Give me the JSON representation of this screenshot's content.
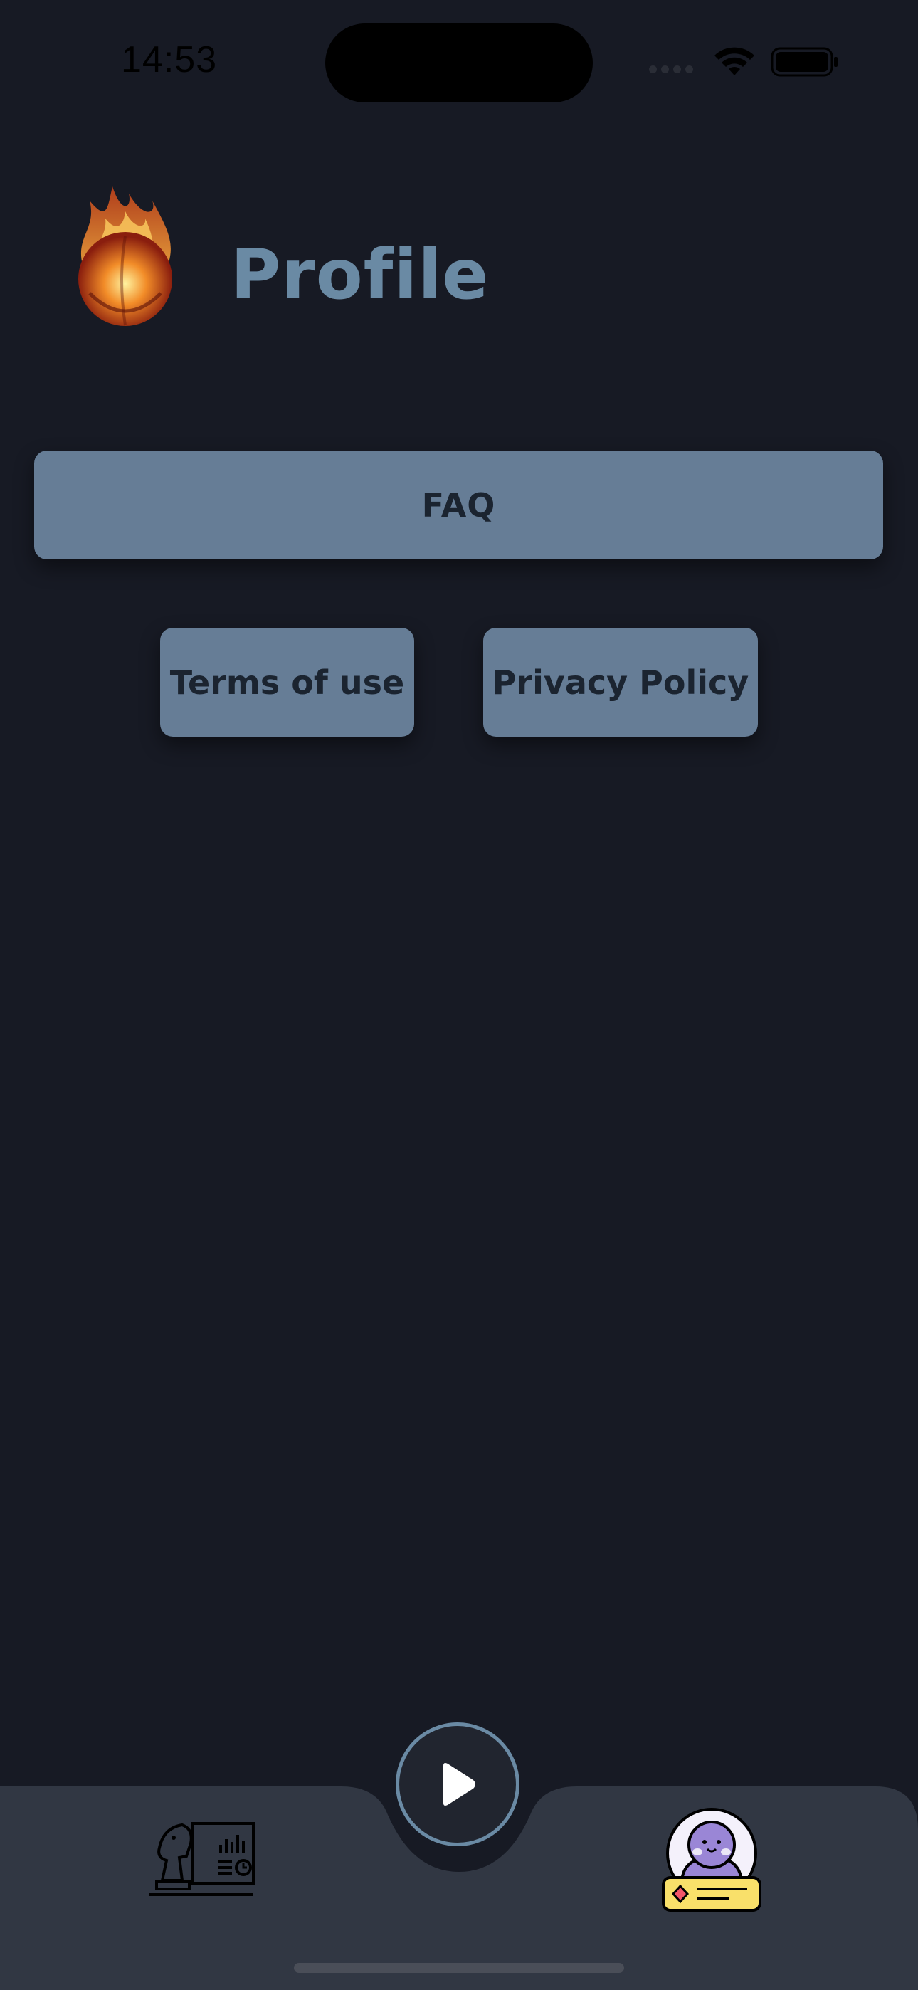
{
  "status_bar": {
    "time": "14:53"
  },
  "header": {
    "title": "Profile",
    "logo_icon": "flaming-ball-icon"
  },
  "buttons": {
    "faq": "FAQ",
    "terms": "Terms of use",
    "privacy": "Privacy Policy"
  },
  "tab_bar": {
    "left_icon": "chess-knight-stats-icon",
    "center_icon": "play-icon",
    "right_icon": "user-profile-card-icon",
    "selected": "profile"
  },
  "colors": {
    "background": "#171a24",
    "button": "#667d96",
    "title": "#6a8aa4",
    "tab_bar": "#313743"
  }
}
